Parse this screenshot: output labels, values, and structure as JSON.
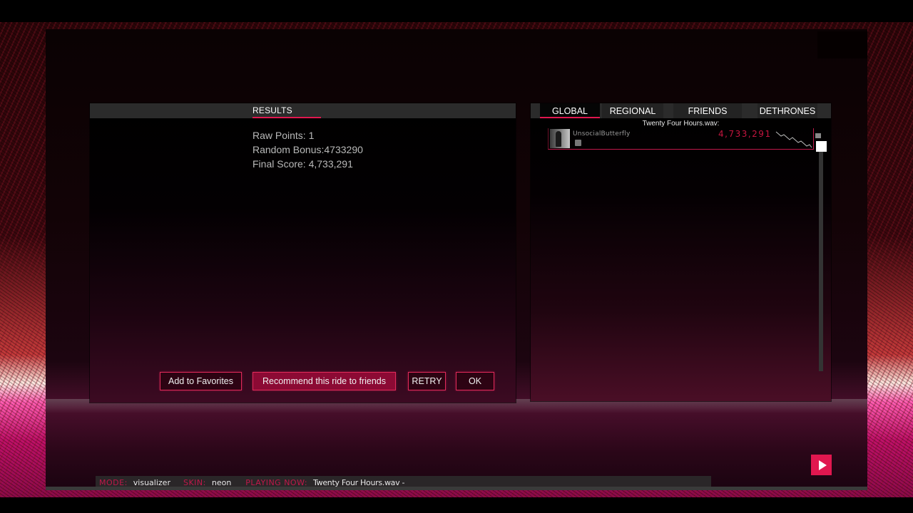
{
  "results_panel": {
    "title": "RESULTS",
    "stats": {
      "raw_points": "Raw Points: 1",
      "random_bonus": "Random Bonus:4733290",
      "final_score": "Final Score: 4,733,291"
    },
    "buttons": {
      "add_favorites": "Add to Favorites",
      "recommend": "Recommend this ride to friends",
      "retry": "RETRY",
      "ok": "OK"
    }
  },
  "leaderboard": {
    "tabs": [
      {
        "label": "GLOBAL",
        "active": true
      },
      {
        "label": "REGIONAL",
        "active": false
      },
      {
        "label": "FRIENDS",
        "active": false
      },
      {
        "label": "DETHRONES",
        "active": false
      }
    ],
    "song_title": "Twenty Four Hours.wav:",
    "entries": [
      {
        "player": "UnsocialButterfly",
        "score": "4,733,291"
      }
    ]
  },
  "status_bar": {
    "mode_label": "MODE:",
    "mode_value": "visualizer",
    "skin_label": "SKIN:",
    "skin_value": "neon",
    "playing_label": "PLAYING NOW:",
    "playing_value": "Twenty Four Hours.wav -"
  },
  "colors": {
    "accent": "#e0174f",
    "score": "#c4153f",
    "panel_header": "#2b2b2b"
  },
  "icons": {
    "play": "play-icon",
    "flag": "flag-icon",
    "badge": "badge-icon"
  }
}
